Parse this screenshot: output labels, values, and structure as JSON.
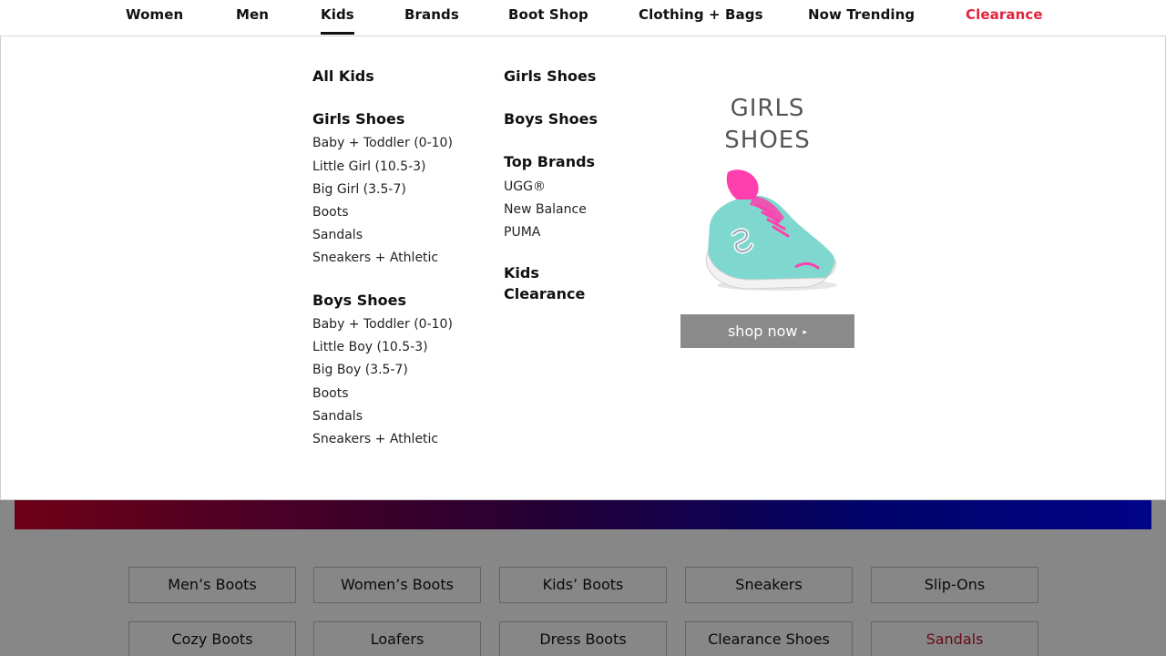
{
  "nav": {
    "items": [
      "Women",
      "Men",
      "Kids",
      "Brands",
      "Boot Shop",
      "Clothing + Bags",
      "Now Trending",
      "Clearance"
    ],
    "active": "Kids",
    "clearance_color": "#e0243c"
  },
  "menu": {
    "col1": {
      "all_kids": "All Kids",
      "girls_heading": "Girls Shoes",
      "girls_links": [
        "Baby + Toddler (0-10)",
        "Little Girl (10.5-3)",
        "Big Girl (3.5-7)",
        "Boots",
        "Sandals",
        "Sneakers + Athletic"
      ],
      "boys_heading": "Boys Shoes",
      "boys_links": [
        "Baby + Toddler (0-10)",
        "Little Boy (10.5-3)",
        "Big Boy (3.5-7)",
        "Boots",
        "Sandals",
        "Sneakers + Athletic"
      ]
    },
    "col2": {
      "girls_shoes": "Girls Shoes",
      "boys_shoes": "Boys Shoes",
      "top_brands_heading": "Top Brands",
      "brands": [
        "UGG®",
        "New Balance",
        "PUMA"
      ],
      "clearance_line1": "Kids",
      "clearance_line2": "Clearance"
    },
    "promo": {
      "title_line1": "GIRLS",
      "title_line2": "SHOES",
      "button": "shop now",
      "button_arrow": "▸",
      "button_color": "#8a8a8a"
    }
  },
  "categories": {
    "row1": [
      "Men’s Boots",
      "Women’s Boots",
      "Kids’ Boots",
      "Sneakers",
      "Slip-Ons"
    ],
    "row2": [
      "Cozy Boots",
      "Loafers",
      "Dress Boots",
      "Clearance Shoes",
      "Sandals"
    ],
    "highlight_color": "#c4162a"
  }
}
